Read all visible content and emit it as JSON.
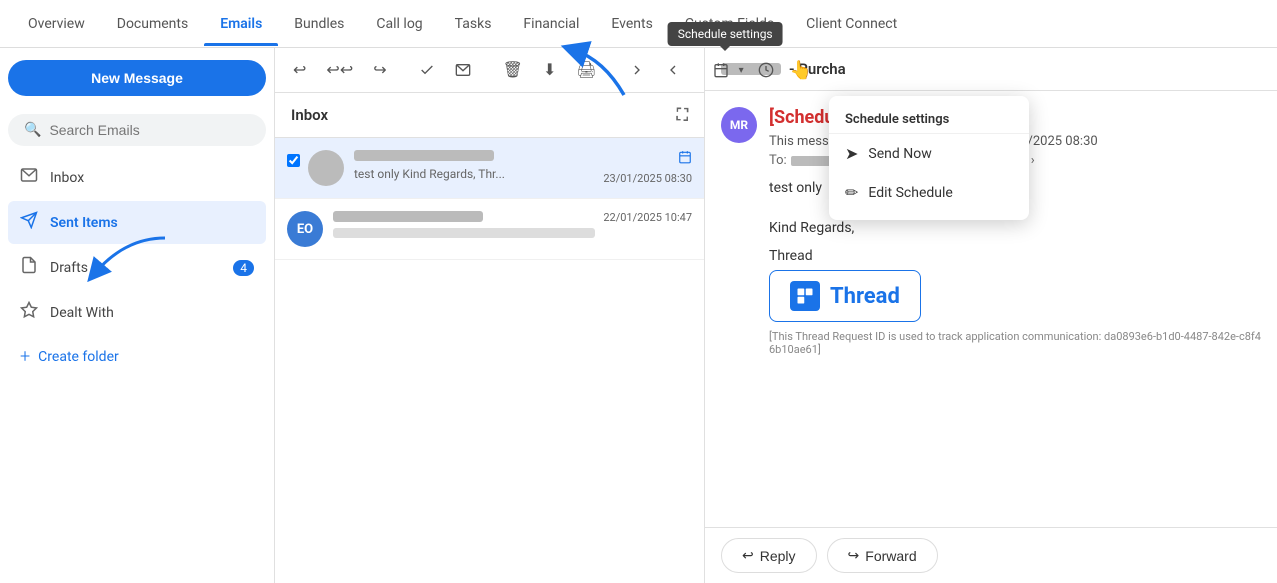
{
  "nav": {
    "items": [
      {
        "label": "Overview",
        "active": false
      },
      {
        "label": "Documents",
        "active": false
      },
      {
        "label": "Emails",
        "active": true
      },
      {
        "label": "Bundles",
        "active": false
      },
      {
        "label": "Call log",
        "active": false
      },
      {
        "label": "Tasks",
        "active": false
      },
      {
        "label": "Financial",
        "active": false
      },
      {
        "label": "Events",
        "active": false
      },
      {
        "label": "Custom Fields",
        "active": false
      },
      {
        "label": "Client Connect",
        "active": false
      }
    ]
  },
  "sidebar": {
    "new_message_label": "New Message",
    "items": [
      {
        "label": "Inbox",
        "icon": "✉",
        "active": false
      },
      {
        "label": "Sent Items",
        "icon": "➤",
        "active": true
      },
      {
        "label": "Drafts",
        "icon": "📋",
        "active": false,
        "badge": "4"
      },
      {
        "label": "Dealt With",
        "icon": "⚑",
        "active": false
      }
    ],
    "create_folder_label": "Create folder"
  },
  "search": {
    "placeholder": "Search Emails"
  },
  "email_list": {
    "header": "Inbox",
    "items": [
      {
        "id": 1,
        "selected": true,
        "avatar_initials": "",
        "avatar_color": "#bbb",
        "preview": "test only Kind Regards, Thr...",
        "time": "23/01/2025 08:30",
        "has_schedule_icon": true
      },
      {
        "id": 2,
        "selected": false,
        "avatar_initials": "EO",
        "avatar_color": "#3a7bd5",
        "preview": "",
        "time": "22/01/2025 10:47",
        "has_schedule_icon": false
      }
    ]
  },
  "toolbar": {
    "buttons": [
      "↩",
      "↩↩",
      "↪",
      "✉",
      "✉",
      "🗑",
      "⬇",
      "🖨",
      "✉",
      "✉",
      "📅",
      "⌛"
    ],
    "schedule_settings_tooltip": "Schedule settings"
  },
  "dropdown": {
    "title": "Schedule settings",
    "items": [
      {
        "label": "Send Now",
        "icon": "➤"
      },
      {
        "label": "Edit Schedule",
        "icon": "✏"
      }
    ]
  },
  "email_viewer": {
    "subject_visible": "- Purcha",
    "sender_initials": "MR",
    "schedule_label": "[Schedule Send]",
    "schedule_info": "This message is scheduled to send on 23/01/2025 08:30",
    "to_label": "To:",
    "body_lines": [
      "test only",
      "",
      "Kind Regards,"
    ],
    "thread_label": "Thread",
    "thread_name": "Thread",
    "thread_icon_letter": "Tr",
    "thread_id": "[This Thread Request ID is used to track application communication: da0893e6-b1d0-4487-842e-c8f46b10ae61]",
    "reply_label": "Reply",
    "forward_label": "Forward"
  }
}
